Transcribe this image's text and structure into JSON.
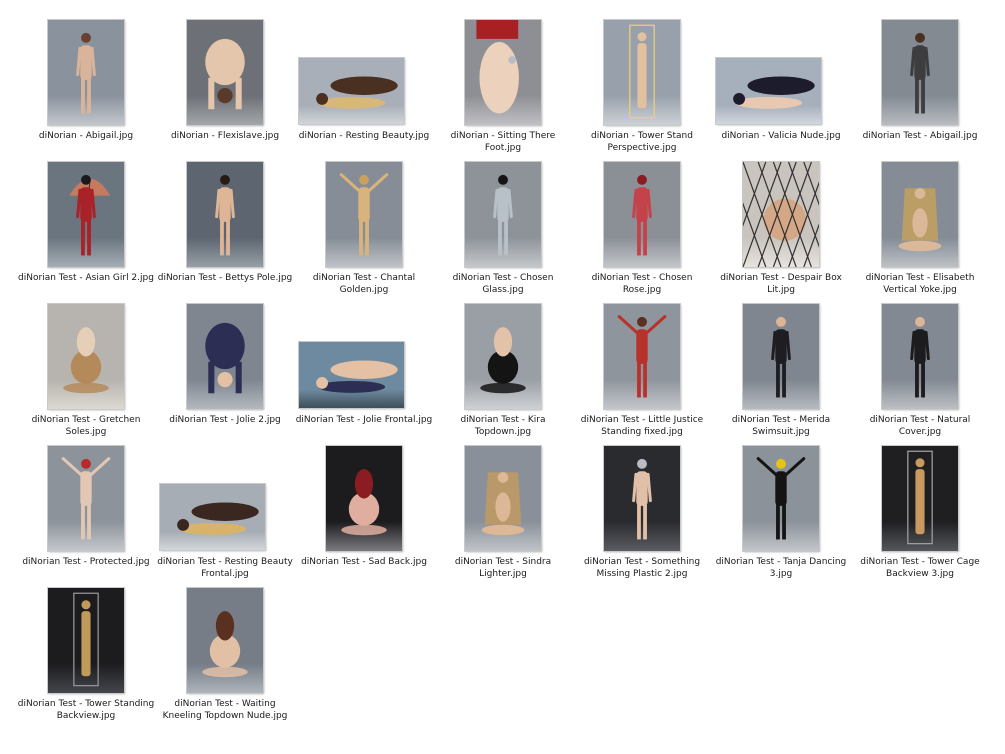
{
  "files": [
    {
      "name": "diNorian - Abigail.jpg",
      "orientation": "portrait",
      "bg": "#8a929e",
      "floor": "#c3c7cc",
      "figure": "#d9b49a",
      "accent": "#6a4030",
      "pose": "stand"
    },
    {
      "name": "diNorian - Flexislave.jpg",
      "orientation": "portrait",
      "bg": "#6d7076",
      "floor": "#a3a6aa",
      "figure": "#e4c6ad",
      "accent": "#5a3a2a",
      "pose": "bend"
    },
    {
      "name": "diNorian - Resting Beauty.jpg",
      "orientation": "landscape",
      "bg": "#a9afb8",
      "floor": "#d2d5d9",
      "figure": "#d8b878",
      "accent": "#4a3020",
      "pose": "lie"
    },
    {
      "name": "diNorian - Sitting There Foot.jpg",
      "orientation": "portrait",
      "bg": "#8e8f94",
      "floor": "#c0c0c4",
      "figure": "#ecd1bc",
      "accent": "#a81f24",
      "pose": "foot"
    },
    {
      "name": "diNorian - Tower Stand Perspective.jpg",
      "orientation": "portrait",
      "bg": "#97a0ab",
      "floor": "#cdd1d6",
      "figure": "#e2c29e",
      "accent": "#e8d07a",
      "pose": "tower"
    },
    {
      "name": "diNorian - Valicia Nude.jpg",
      "orientation": "landscape",
      "bg": "#a6b0bc",
      "floor": "#d2d7dd",
      "figure": "#e8c8b0",
      "accent": "#1c1c2c",
      "pose": "lie"
    },
    {
      "name": "diNorian Test - Abigail.jpg",
      "orientation": "portrait",
      "bg": "#838a92",
      "floor": "#b8bcc1",
      "figure": "#3d3d40",
      "accent": "#4a3020",
      "pose": "stand"
    },
    {
      "name": "diNorian Test - Asian Girl 2.jpg",
      "orientation": "portrait",
      "bg": "#6a7580",
      "floor": "#a5adb5",
      "figure": "#a82228",
      "accent": "#c67a60",
      "pose": "umbrella"
    },
    {
      "name": "diNorian Test - Bettys Pole.jpg",
      "orientation": "portrait",
      "bg": "#5d6670",
      "floor": "#979ea6",
      "figure": "#dfb597",
      "accent": "#2a1a14",
      "pose": "stand"
    },
    {
      "name": "diNorian Test - Chantal Golden.jpg",
      "orientation": "portrait",
      "bg": "#868d96",
      "floor": "#bfc3c8",
      "figure": "#d8b47c",
      "accent": "#c9a060",
      "pose": "arms"
    },
    {
      "name": "diNorian Test - Chosen Glass.jpg",
      "orientation": "portrait",
      "bg": "#8e939a",
      "floor": "#c4c7cb",
      "figure": "#b8c0c8",
      "accent": "#151515",
      "pose": "stand"
    },
    {
      "name": "diNorian Test - Chosen Rose.jpg",
      "orientation": "portrait",
      "bg": "#8b9097",
      "floor": "#c2c5c9",
      "figure": "#c4434a",
      "accent": "#8a1c22",
      "pose": "stand"
    },
    {
      "name": "diNorian Test - Despair Box Lit.jpg",
      "orientation": "portrait",
      "bg": "#c9c4be",
      "floor": "#e6e2dc",
      "figure": "#d4a886",
      "accent": "#303030",
      "pose": "cage"
    },
    {
      "name": "diNorian Test - Elisabeth Vertical Yoke.jpg",
      "orientation": "portrait",
      "bg": "#858c95",
      "floor": "#bcc1c6",
      "figure": "#dcb89a",
      "accent": "#c7a35a",
      "pose": "sit"
    },
    {
      "name": "diNorian Test - Gretchen Soles.jpg",
      "orientation": "portrait",
      "bg": "#b7b3ae",
      "floor": "#dcd8d2",
      "figure": "#b58a5a",
      "accent": "#e6cfb8",
      "pose": "kneel"
    },
    {
      "name": "diNorian Test - Jolie 2.jpg",
      "orientation": "portrait",
      "bg": "#7f8690",
      "floor": "#b4b9bf",
      "figure": "#2c2e54",
      "accent": "#e4c0a4",
      "pose": "bend"
    },
    {
      "name": "diNorian Test - Jolie Frontal.jpg",
      "orientation": "landscape",
      "bg": "#6e8aa0",
      "floor": "#3e4e5a",
      "figure": "#2c2e54",
      "accent": "#e4c0a4",
      "pose": "lie"
    },
    {
      "name": "diNorian Test - Kira Topdown.jpg",
      "orientation": "portrait",
      "bg": "#9a9fa6",
      "floor": "#cdd0d4",
      "figure": "#141414",
      "accent": "#e2c2a8",
      "pose": "kneel"
    },
    {
      "name": "diNorian Test - Little Justice Standing fixed.jpg",
      "orientation": "portrait",
      "bg": "#8f959d",
      "floor": "#c3c7cb",
      "figure": "#b8322c",
      "accent": "#5a3020",
      "pose": "arms"
    },
    {
      "name": "diNorian Test - Merida Swimsuit.jpg",
      "orientation": "portrait",
      "bg": "#80868f",
      "floor": "#b6bbc1",
      "figure": "#1d1d22",
      "accent": "#dcb498",
      "pose": "stand"
    },
    {
      "name": "diNorian Test - Natural Cover.jpg",
      "orientation": "portrait",
      "bg": "#838992",
      "floor": "#bcc0c5",
      "figure": "#1c1c1f",
      "accent": "#dcb498",
      "pose": "stand"
    },
    {
      "name": "diNorian Test - Protected.jpg",
      "orientation": "portrait",
      "bg": "#8d939b",
      "floor": "#c4c8cc",
      "figure": "#e2c8b4",
      "accent": "#b82a2a",
      "pose": "arms"
    },
    {
      "name": "diNorian Test - Resting Beauty Frontal.jpg",
      "orientation": "landscape",
      "bg": "#a7adb5",
      "floor": "#d3d6da",
      "figure": "#d8b46a",
      "accent": "#3a2820",
      "pose": "lie"
    },
    {
      "name": "diNorian Test - Sad Back.jpg",
      "orientation": "portrait",
      "bg": "#1c1c1f",
      "floor": "#7a7a80",
      "figure": "#e0aea0",
      "accent": "#8a1c22",
      "pose": "kneel"
    },
    {
      "name": "diNorian Test - Sindra Lighter.jpg",
      "orientation": "portrait",
      "bg": "#8a9099",
      "floor": "#c0c4c9",
      "figure": "#dcb896",
      "accent": "#c49a5c",
      "pose": "sit"
    },
    {
      "name": "diNorian Test - Something Missing Plastic 2.jpg",
      "orientation": "portrait",
      "bg": "#2a2b2f",
      "floor": "#5a5c62",
      "figure": "#e0c0a8",
      "accent": "#b8bcc4",
      "pose": "stand"
    },
    {
      "name": "diNorian Test - Tanja Dancing 3.jpg",
      "orientation": "portrait",
      "bg": "#8c929a",
      "floor": "#c2c6ca",
      "figure": "#141414",
      "accent": "#e6c414",
      "pose": "arms"
    },
    {
      "name": "diNorian Test - Tower Cage Backview 3.jpg",
      "orientation": "portrait",
      "bg": "#1f1f22",
      "floor": "#55575c",
      "figure": "#c89a60",
      "accent": "#9a9da2",
      "pose": "tower"
    },
    {
      "name": "diNorian Test - Tower Standing Backview.jpg",
      "orientation": "portrait",
      "bg": "#1c1c1f",
      "floor": "#44464b",
      "figure": "#c09a5a",
      "accent": "#8f9297",
      "pose": "tower"
    },
    {
      "name": "diNorian Test - Waiting Kneeling Topdown Nude.jpg",
      "orientation": "portrait",
      "bg": "#767d87",
      "floor": "#aeb4ba",
      "figure": "#e2c0a6",
      "accent": "#5a3020",
      "pose": "kneel"
    }
  ]
}
